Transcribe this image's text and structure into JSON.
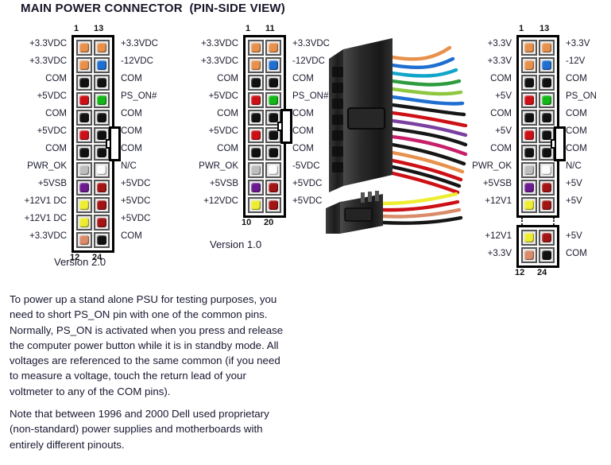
{
  "title": "MAIN POWER CONNECTOR  (PIN-SIDE VIEW)",
  "colors": {
    "orange": "#e8914c",
    "blue": "#1f6fd0",
    "black": "#111111",
    "red": "#cc1016",
    "green": "#13b818",
    "gray": "#bdbdbd",
    "white": "#fbfbfb",
    "purple": "#6b1a8f",
    "yellow": "#eded32",
    "darkred": "#a31414",
    "salmon": "#d98b6a"
  },
  "connectors": [
    {
      "id": "version20",
      "caption": "Version 2.0",
      "top_left_num": "1",
      "top_right_num": "13",
      "bottom_left_num": "12",
      "bottom_right_num": "24",
      "rows": [
        {
          "left_label": "+3.3VDC",
          "left_color": "orange",
          "right_label": "+3.3VDC",
          "right_color": "orange"
        },
        {
          "left_label": "+3.3VDC",
          "left_color": "orange",
          "right_label": "-12VDC",
          "right_color": "blue"
        },
        {
          "left_label": "COM",
          "left_color": "black",
          "right_label": "COM",
          "right_color": "black"
        },
        {
          "left_label": "+5VDC",
          "left_color": "red",
          "right_label": "PS_ON#",
          "right_color": "green"
        },
        {
          "left_label": "COM",
          "left_color": "black",
          "right_label": "COM",
          "right_color": "black"
        },
        {
          "left_label": "+5VDC",
          "left_color": "red",
          "right_label": "COM",
          "right_color": "black"
        },
        {
          "left_label": "COM",
          "left_color": "black",
          "right_label": "COM",
          "right_color": "black"
        },
        {
          "left_label": "PWR_OK",
          "left_color": "gray",
          "right_label": "N/C",
          "right_color": "white"
        },
        {
          "left_label": "+5VSB",
          "left_color": "purple",
          "right_label": "+5VDC",
          "right_color": "darkred"
        },
        {
          "left_label": "+12V1 DC",
          "left_color": "yellow",
          "right_label": "+5VDC",
          "right_color": "darkred"
        },
        {
          "left_label": "+12V1 DC",
          "left_color": "yellow",
          "right_label": "+5VDC",
          "right_color": "darkred"
        },
        {
          "left_label": "+3.3VDC",
          "left_color": "salmon",
          "right_label": "COM",
          "right_color": "black"
        }
      ]
    },
    {
      "id": "version10",
      "caption": "Version 1.0",
      "top_left_num": "1",
      "top_right_num": "11",
      "bottom_left_num": "10",
      "bottom_right_num": "20",
      "rows": [
        {
          "left_label": "+3.3VDC",
          "left_color": "orange",
          "right_label": "+3.3VDC",
          "right_color": "orange"
        },
        {
          "left_label": "+3.3VDC",
          "left_color": "orange",
          "right_label": "-12VDC",
          "right_color": "blue"
        },
        {
          "left_label": "COM",
          "left_color": "black",
          "right_label": "COM",
          "right_color": "black"
        },
        {
          "left_label": "+5VDC",
          "left_color": "red",
          "right_label": "PS_ON#",
          "right_color": "green"
        },
        {
          "left_label": "COM",
          "left_color": "black",
          "right_label": "COM",
          "right_color": "black"
        },
        {
          "left_label": "+5VDC",
          "left_color": "red",
          "right_label": "COM",
          "right_color": "black"
        },
        {
          "left_label": "COM",
          "left_color": "black",
          "right_label": "COM",
          "right_color": "black"
        },
        {
          "left_label": "PWR_OK",
          "left_color": "gray",
          "right_label": "-5VDC",
          "right_color": "white"
        },
        {
          "left_label": "+5VSB",
          "left_color": "purple",
          "right_label": "+5VDC",
          "right_color": "darkred"
        },
        {
          "left_label": "+12VDC",
          "left_color": "yellow",
          "right_label": "+5VDC",
          "right_color": "darkred"
        }
      ]
    }
  ],
  "photo_connector": {
    "id": "photo-24pin",
    "top_left_num": "1",
    "top_right_num": "13",
    "bottom_left_num": "12",
    "bottom_right_num": "24",
    "main_rows": [
      {
        "left_label": "+3.3V",
        "left_color": "orange",
        "right_label": "+3.3V",
        "right_color": "orange"
      },
      {
        "left_label": "+3.3V",
        "left_color": "orange",
        "right_label": "-12V",
        "right_color": "blue"
      },
      {
        "left_label": "COM",
        "left_color": "black",
        "right_label": "COM",
        "right_color": "black"
      },
      {
        "left_label": "+5V",
        "left_color": "red",
        "right_label": "PS_ON",
        "right_color": "green"
      },
      {
        "left_label": "COM",
        "left_color": "black",
        "right_label": "COM",
        "right_color": "black"
      },
      {
        "left_label": "+5V",
        "left_color": "red",
        "right_label": "COM",
        "right_color": "black"
      },
      {
        "left_label": "COM",
        "left_color": "black",
        "right_label": "COM",
        "right_color": "black"
      },
      {
        "left_label": "PWR_OK",
        "left_color": "gray",
        "right_label": "N/C",
        "right_color": "white"
      },
      {
        "left_label": "+5VSB",
        "left_color": "purple",
        "right_label": "+5V",
        "right_color": "darkred"
      },
      {
        "left_label": "+12V1",
        "left_color": "yellow",
        "right_label": "+5V",
        "right_color": "darkred"
      }
    ],
    "detached_rows": [
      {
        "left_label": "+12V1",
        "left_color": "yellow",
        "right_label": "+5V",
        "right_color": "darkred"
      },
      {
        "left_label": "+3.3V",
        "left_color": "salmon",
        "right_label": "COM",
        "right_color": "black"
      }
    ]
  },
  "caption": {
    "paragraph1": "To power up a stand alone PSU for testing purposes, you need to short PS_ON pin with one of the common pins. Normally, PS_ON is activated when you press and release the computer power button while it is in standby mode. All voltages are referenced to the same common (if you need to measure a voltage, touch the return lead of your voltmeter to any of the COM pins).",
    "paragraph2": "Note that between 1996 and 2000 Dell used proprietary (non-standard) power supplies and motherboards with entirely different pinouts."
  }
}
